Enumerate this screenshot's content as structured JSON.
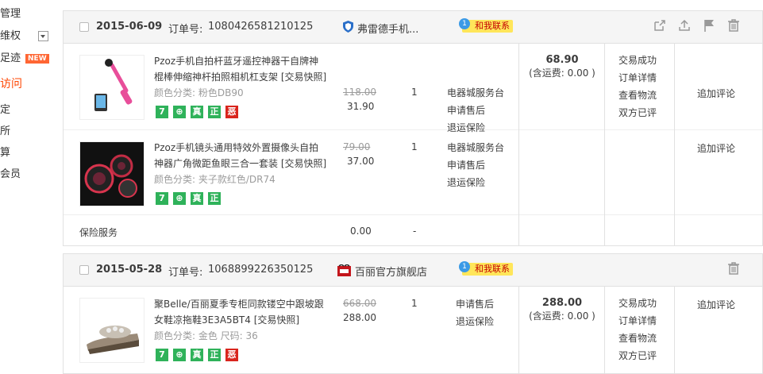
{
  "sidebar": {
    "items": [
      {
        "label": "管理"
      },
      {
        "label": "维权"
      },
      {
        "label": "足迹",
        "badge": "NEW"
      },
      {
        "label": "访问"
      },
      {
        "label": "定"
      },
      {
        "label": "所"
      },
      {
        "label": "算"
      },
      {
        "label": "会员"
      }
    ]
  },
  "orders": [
    {
      "date": "2015-06-09",
      "order_no_label": "订单号:",
      "order_no": "1080426581210125",
      "shop": "弗雷德手机...",
      "contact": "和我联系",
      "total": "68.90",
      "shipping": "(含运费: 0.00 )",
      "status": [
        "交易成功",
        "订单详情",
        "查看物流",
        "双方已评"
      ],
      "items": [
        {
          "title": "Pzoz手机自拍杆蓝牙遥控神器干自牌神棍棒伸缩神杆拍照相机杠支架 [交易快照]",
          "variant": "颜色分类: 粉色DB90",
          "orig_price": "118.00",
          "price": "31.90",
          "qty": "1",
          "links": [
            "电器城服务台",
            "申请售后",
            "退运保险"
          ],
          "comment": "追加评论",
          "tags": [
            "7",
            "⊕",
            "真",
            "正",
            "恶"
          ]
        },
        {
          "title": "Pzoz手机镜头通用特效外置摄像头自拍神器广角微距鱼眼三合一套装 [交易快照]",
          "variant": "颜色分类: 夹子款红色/DR74",
          "orig_price": "79.00",
          "price": "37.00",
          "qty": "1",
          "links": [
            "电器城服务台",
            "申请售后",
            "退运保险"
          ],
          "comment": "追加评论",
          "tags": [
            "7",
            "⊕",
            "真",
            "正"
          ]
        }
      ],
      "insurance": {
        "label": "保险服务",
        "price": "0.00",
        "qty": "-"
      }
    },
    {
      "date": "2015-05-28",
      "order_no_label": "订单号:",
      "order_no": "1068899226350125",
      "shop": "百丽官方旗舰店",
      "contact": "和我联系",
      "total": "288.00",
      "shipping": "(含运费: 0.00 )",
      "status": [
        "交易成功",
        "订单详情",
        "查看物流",
        "双方已评"
      ],
      "items": [
        {
          "title": "聚Belle/百丽夏季专柜同款镂空中跟坡跟女鞋凉拖鞋3E3A5BT4 [交易快照]",
          "variant": "颜色分类: 金色 尺码: 36",
          "orig_price": "668.00",
          "price": "288.00",
          "qty": "1",
          "links": [
            "申请售后",
            "退运保险"
          ],
          "comment": "追加评论",
          "tags": [
            "7",
            "⊕",
            "真",
            "正",
            "恶"
          ]
        }
      ]
    }
  ],
  "colors": {
    "accent": "#ff4400",
    "tag_green": "#2fb25a",
    "tag_red": "#d9251d",
    "contact_bg": "#ffe65a"
  },
  "icons": [
    "share-icon",
    "upload-icon",
    "flag-icon",
    "trash-icon",
    "shield-icon",
    "shop-logo-icon",
    "chat-bubble-icon",
    "checkbox-icon",
    "dropdown-icon"
  ]
}
